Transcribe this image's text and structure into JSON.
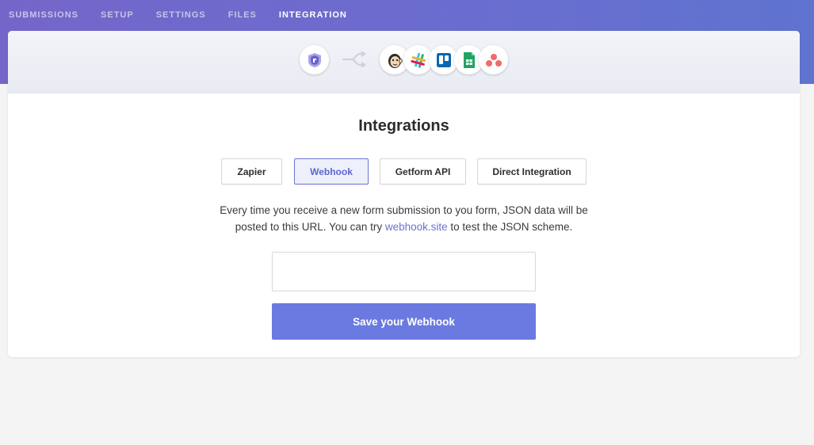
{
  "nav": {
    "items": [
      {
        "label": "SUBMISSIONS",
        "active": false
      },
      {
        "label": "SETUP",
        "active": false
      },
      {
        "label": "SETTINGS",
        "active": false
      },
      {
        "label": "FILES",
        "active": false
      },
      {
        "label": "INTEGRATION",
        "active": true
      }
    ]
  },
  "header_icons": [
    "getform-icon",
    "shuffle-icon",
    "mailchimp-icon",
    "slack-icon",
    "trello-icon",
    "google-sheets-icon",
    "asana-icon"
  ],
  "main": {
    "title": "Integrations",
    "tabs": [
      {
        "label": "Zapier",
        "active": false
      },
      {
        "label": "Webhook",
        "active": true
      },
      {
        "label": "Getform API",
        "active": false
      },
      {
        "label": "Direct Integration",
        "active": false
      }
    ],
    "description_line1": "Every time you receive a new form submission to you form, JSON data will be",
    "description_line2_pre": "posted to this URL. You can try ",
    "description_link": "webhook.site",
    "description_line2_post": " to test the JSON scheme.",
    "webhook_url_value": "",
    "save_label": "Save your Webhook"
  },
  "colors": {
    "accent": "#6b7ae0",
    "active_tab_border": "#6b74d6",
    "link": "#6b72d0"
  }
}
